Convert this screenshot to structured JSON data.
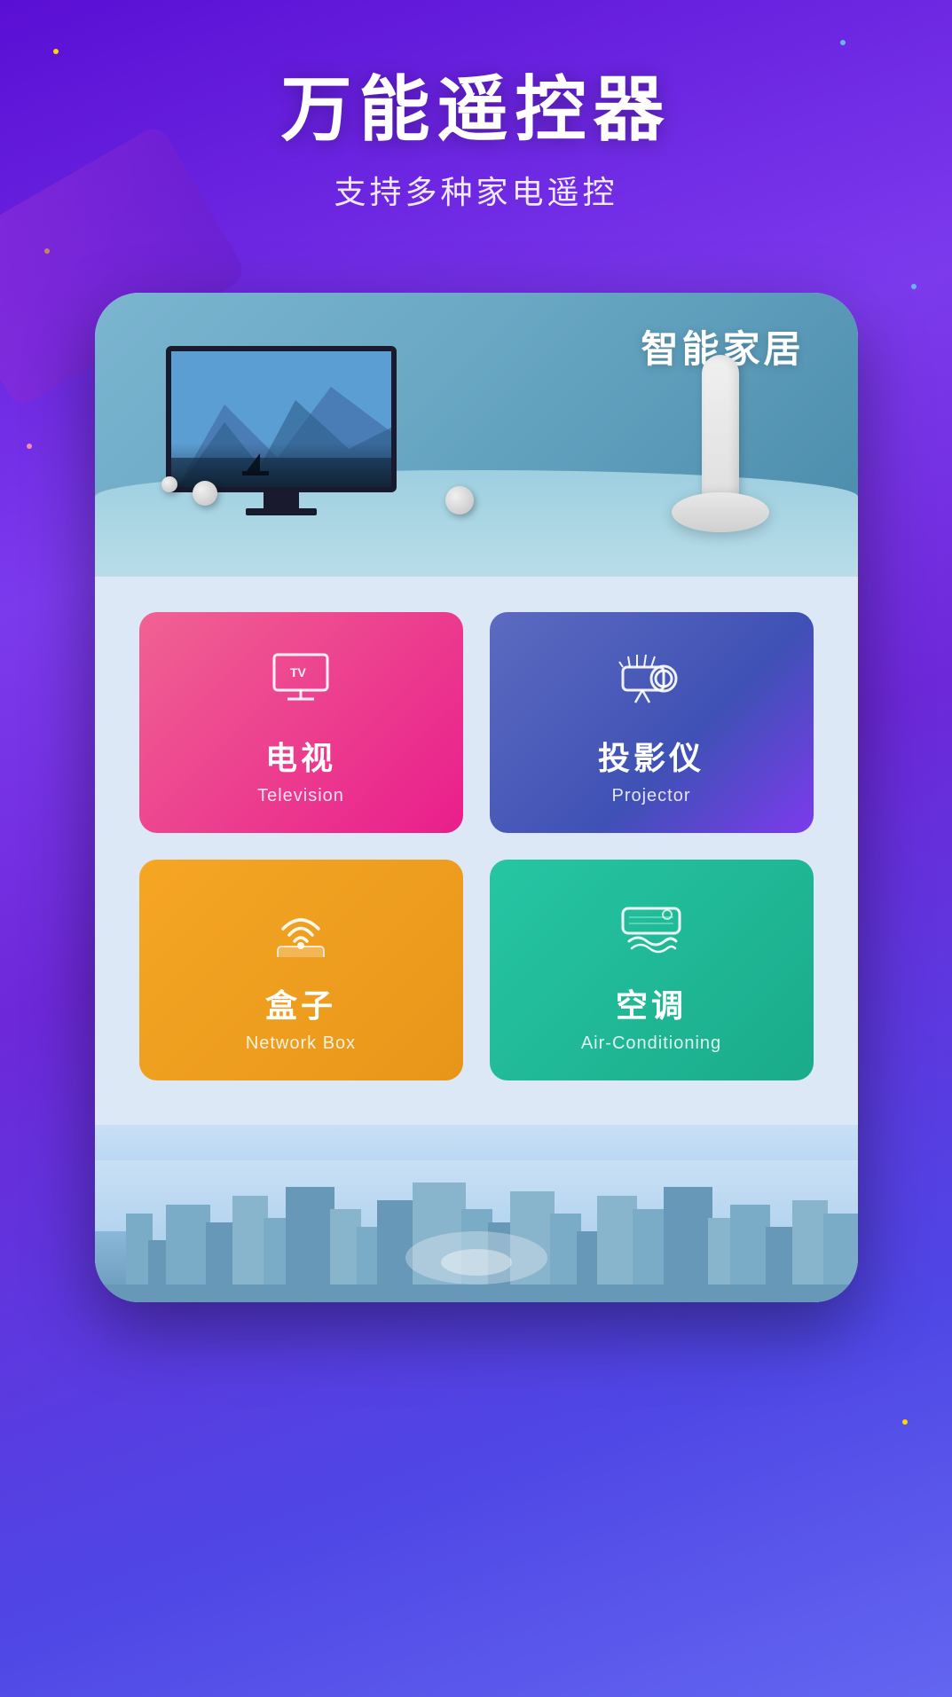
{
  "header": {
    "title": "万能遥控器",
    "subtitle": "支持多种家电遥控"
  },
  "banner": {
    "title": "智能家居"
  },
  "devices": [
    {
      "id": "television",
      "name_zh": "电视",
      "name_en": "Television",
      "icon": "tv"
    },
    {
      "id": "projector",
      "name_zh": "投影仪",
      "name_en": "Projector",
      "icon": "projector"
    },
    {
      "id": "network-box",
      "name_zh": "盒子",
      "name_en": "Network Box",
      "icon": "network"
    },
    {
      "id": "air-conditioning",
      "name_zh": "空调",
      "name_en": "Air-Conditioning",
      "icon": "ac"
    }
  ]
}
